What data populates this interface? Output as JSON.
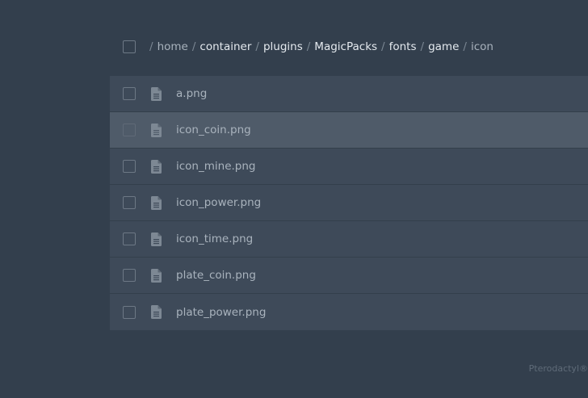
{
  "breadcrumb": {
    "separator": "/",
    "items": [
      {
        "label": "home",
        "style": "muted"
      },
      {
        "label": "container",
        "style": "link"
      },
      {
        "label": "plugins",
        "style": "link"
      },
      {
        "label": "MagicPacks",
        "style": "link"
      },
      {
        "label": "fonts",
        "style": "link"
      },
      {
        "label": "game",
        "style": "link"
      },
      {
        "label": "icon",
        "style": "current"
      }
    ]
  },
  "files": [
    {
      "name": "a.png",
      "icon": "file-icon",
      "highlighted": false
    },
    {
      "name": "icon_coin.png",
      "icon": "file-icon",
      "highlighted": true
    },
    {
      "name": "icon_mine.png",
      "icon": "file-icon",
      "highlighted": false
    },
    {
      "name": "icon_power.png",
      "icon": "file-icon",
      "highlighted": false
    },
    {
      "name": "icon_time.png",
      "icon": "file-icon",
      "highlighted": false
    },
    {
      "name": "plate_coin.png",
      "icon": "file-icon",
      "highlighted": false
    },
    {
      "name": "plate_power.png",
      "icon": "file-icon",
      "highlighted": false
    }
  ],
  "footer": {
    "text": "Pterodactyl®"
  },
  "colors": {
    "background": "#333f4d",
    "row": "#3e4a59",
    "row_highlight": "#4f5b69",
    "icon": "#7d8894"
  }
}
